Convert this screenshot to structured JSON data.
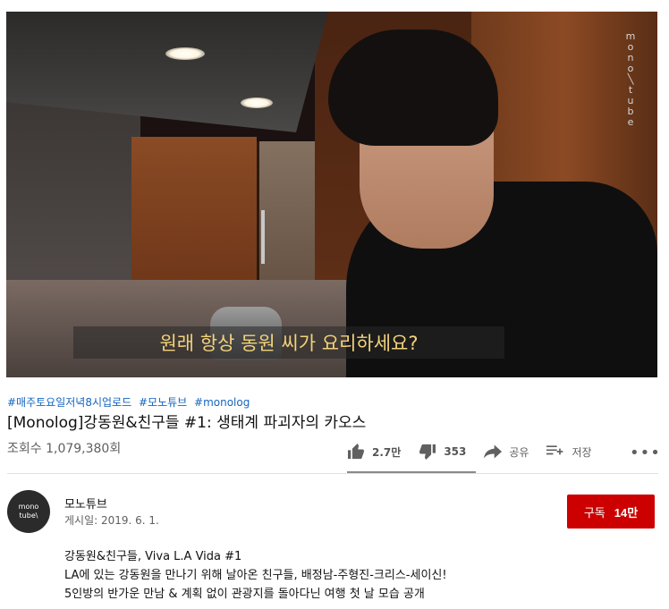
{
  "video": {
    "subtitle": "원래 항상 동원 씨가 요리하세요?",
    "watermark_chars": [
      "m",
      "o",
      "n",
      "o",
      "╲",
      "t",
      "u",
      "b",
      "e"
    ]
  },
  "hashtags": [
    "#매주토요일저녁8시업로드",
    "#모노튜브",
    "#monolog"
  ],
  "title": "[Monolog]강동원&친구들 #1: 생태계 파괴자의 카오스",
  "views": "조회수 1,079,380회",
  "actions": {
    "like_count": "2.7만",
    "dislike_count": "353",
    "share_label": "공유",
    "save_label": "저장",
    "more_label": "•••",
    "like_ratio": 0.987
  },
  "channel": {
    "avatar_text": [
      "mono",
      "tube\\"
    ],
    "name": "모노튜브",
    "published": "게시일: 2019. 6. 1."
  },
  "subscribe": {
    "label": "구독",
    "count": "14만",
    "color": "#cc0000"
  },
  "description": [
    "강동원&친구들, Viva L.A Vida #1",
    "LA에 있는 강동원을 만나기 위해 날아온 친구들, 배정남-주형진-크리스-세이신!",
    "5인방의 반가운 만남 & 계획 없이 관광지를 돌아다닌 여행 첫 날 모습 공개"
  ]
}
